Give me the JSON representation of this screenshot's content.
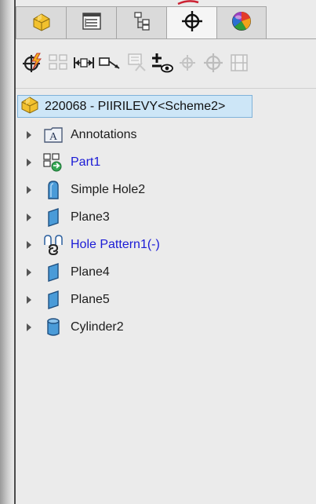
{
  "tabs": [
    {
      "icon": "feature-manager-icon",
      "active": false
    },
    {
      "icon": "property-manager-icon",
      "active": false
    },
    {
      "icon": "configuration-manager-icon",
      "active": false
    },
    {
      "icon": "dimxpert-manager-icon",
      "active": true
    },
    {
      "icon": "display-manager-icon",
      "active": false
    }
  ],
  "toolbar": {
    "buttons": [
      {
        "icon": "auto-dimension-scheme-icon",
        "enabled": true
      },
      {
        "icon": "datum-feature-icon",
        "enabled": false
      },
      {
        "icon": "size-dimension-icon",
        "enabled": true
      },
      {
        "icon": "location-dimension-icon",
        "enabled": true
      },
      {
        "icon": "pattern-feature-icon",
        "enabled": false
      },
      {
        "icon": "show-tolerance-status-icon",
        "enabled": true
      },
      {
        "icon": "copy-scheme-icon",
        "enabled": false
      },
      {
        "icon": "tts-import-icon",
        "enabled": false
      },
      {
        "icon": "delete-all-icon",
        "enabled": false
      }
    ]
  },
  "tree": {
    "root": {
      "label": "220068 - PIIRILEVY<Scheme2>",
      "icon": "part-icon"
    },
    "items": [
      {
        "label": "Annotations",
        "icon": "annotations-icon",
        "color": "dark"
      },
      {
        "label": "Part1",
        "icon": "part-feature-icon",
        "color": "blue"
      },
      {
        "label": "Simple Hole2",
        "icon": "simple-hole-icon",
        "color": "dark"
      },
      {
        "label": "Plane3",
        "icon": "plane-icon",
        "color": "dark"
      },
      {
        "label": "Hole Pattern1(-)",
        "icon": "hole-pattern-icon",
        "color": "blue"
      },
      {
        "label": "Plane4",
        "icon": "plane-icon",
        "color": "dark"
      },
      {
        "label": "Plane5",
        "icon": "plane-icon",
        "color": "dark"
      },
      {
        "label": "Cylinder2",
        "icon": "cylinder-icon",
        "color": "dark"
      }
    ]
  }
}
